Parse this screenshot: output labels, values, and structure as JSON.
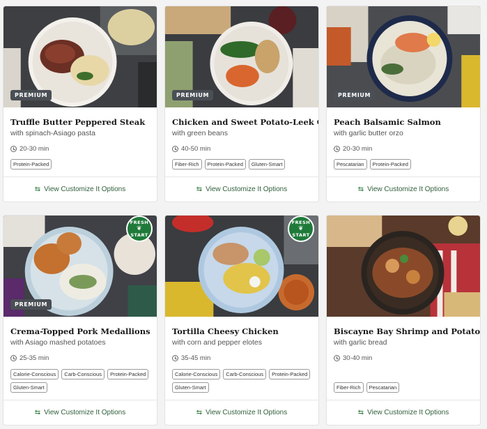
{
  "cards": [
    {
      "title": "Truffle Butter Peppered Steak",
      "subtitle": "with spinach-Asiago pasta",
      "time": "20-30 min",
      "badge": "PREMIUM",
      "tags": [
        "Protein-Packed"
      ],
      "cta": "View Customize It Options"
    },
    {
      "title": "Chicken and Sweet Potato-Leek Gratin",
      "subtitle": "with green beans",
      "time": "40-50 min",
      "badge": "PREMIUM",
      "tags": [
        "Fiber-Rich",
        "Protein-Packed",
        "Gluten-Smart"
      ],
      "cta": "View Customize It Options"
    },
    {
      "title": "Peach Balsamic Salmon",
      "subtitle": "with garlic butter orzo",
      "time": "20-30 min",
      "badge": "PREMIUM",
      "tags": [
        "Pescatarian",
        "Protein-Packed"
      ],
      "cta": "View Customize It Options"
    },
    {
      "title": "Crema-Topped Pork Medallions",
      "subtitle": "with Asiago mashed potatoes",
      "time": "25-35 min",
      "badge": "PREMIUM",
      "fresh_start": [
        "FRESH",
        "START"
      ],
      "tags": [
        "Calorie-Conscious",
        "Carb-Conscious",
        "Protein-Packed",
        "Gluten-Smart"
      ],
      "cta": "View Customize It Options"
    },
    {
      "title": "Tortilla Cheesy Chicken",
      "subtitle": "with corn and pepper elotes",
      "time": "35-45 min",
      "fresh_start": [
        "FRESH",
        "START"
      ],
      "tags": [
        "Calorie-Conscious",
        "Carb-Conscious",
        "Protein-Packed",
        "Gluten-Smart"
      ],
      "cta": "View Customize It Options"
    },
    {
      "title": "Biscayne Bay Shrimp and Potatoes",
      "subtitle": "with garlic bread",
      "time": "30-40 min",
      "tags": [
        "Fiber-Rich",
        "Pescatarian"
      ],
      "cta": "View Customize It Options"
    }
  ],
  "icons": {
    "clock": "clock-icon",
    "swap": "swap-arrows-icon",
    "fresh": "leaf-icon"
  },
  "colors": {
    "accent_green": "#2f7a3d",
    "premium_badge": "#4a4f55",
    "fresh_badge": "#1f7a3a"
  }
}
